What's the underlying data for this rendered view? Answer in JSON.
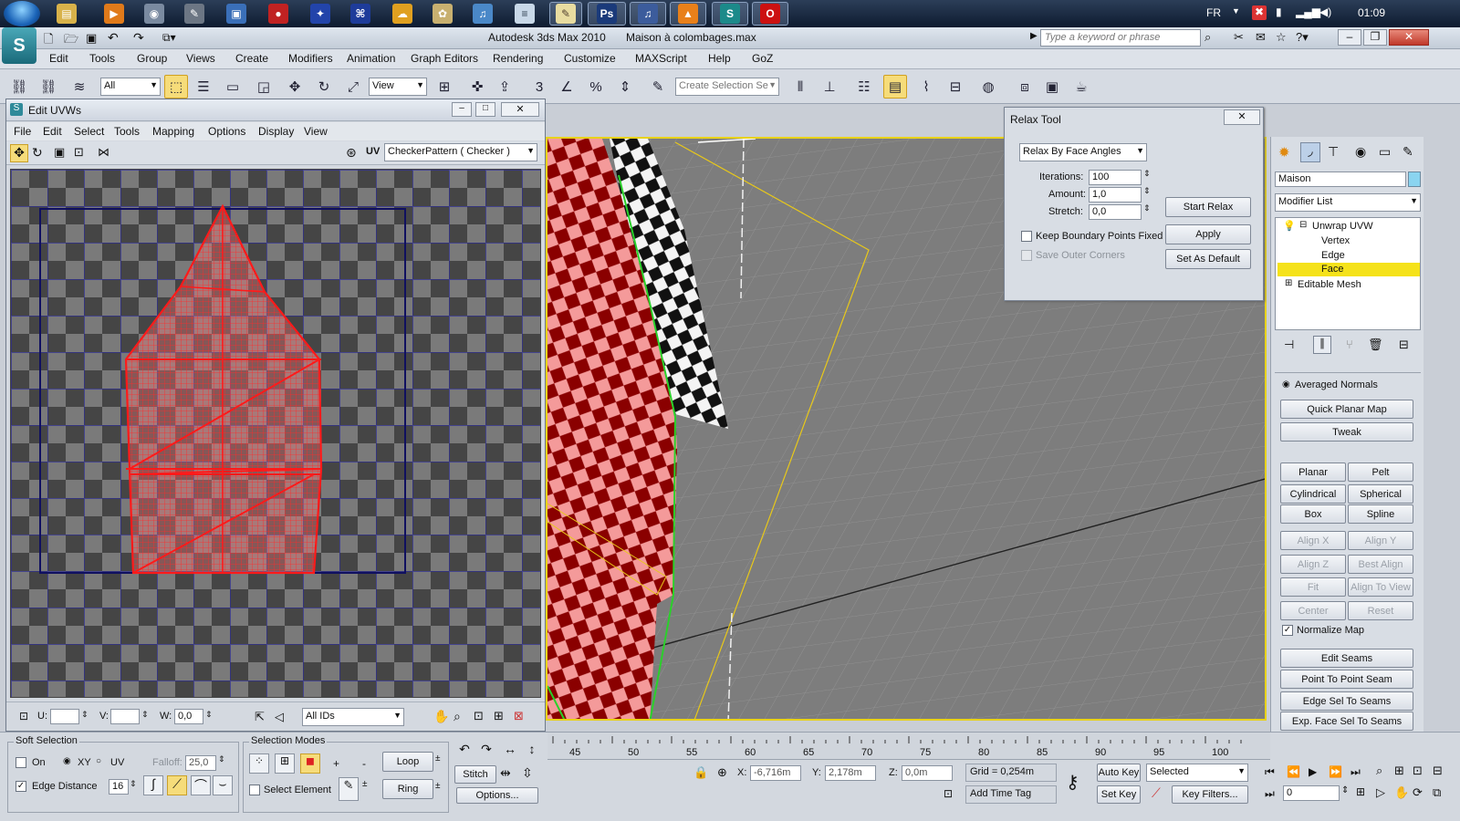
{
  "taskbar": {
    "language": "FR",
    "clock": "01:09"
  },
  "window": {
    "app_title": "Autodesk 3ds Max 2010",
    "file_title": "Maison à colombages.max",
    "search_placeholder": "Type a keyword or phrase"
  },
  "menu": [
    "Edit",
    "Tools",
    "Group",
    "Views",
    "Create",
    "Modifiers",
    "Animation",
    "Graph Editors",
    "Rendering",
    "Customize",
    "MAXScript",
    "Help",
    "GoZ"
  ],
  "toolbar": {
    "filter_value": "All",
    "refcoord_value": "View",
    "selection_set_placeholder": "Create Selection Se"
  },
  "uvw_editor": {
    "title": "Edit UVWs",
    "menu": [
      "File",
      "Edit",
      "Select",
      "Tools",
      "Mapping",
      "Options",
      "Display",
      "View"
    ],
    "uv_label": "UV",
    "texture_value": "CheckerPattern  ( Checker )",
    "u_label": "U:",
    "v_label": "V:",
    "w_label": "W:",
    "w_value": "0,0",
    "ids_value": "All IDs"
  },
  "relax_tool": {
    "title": "Relax Tool",
    "mode_value": "Relax By Face Angles",
    "iterations_label": "Iterations:",
    "iterations_value": "100",
    "amount_label": "Amount:",
    "amount_value": "1,0",
    "stretch_label": "Stretch:",
    "stretch_value": "0,0",
    "keep_boundary_label": "Keep Boundary Points Fixed",
    "save_outer_label": "Save Outer Corners",
    "start_relax_label": "Start Relax",
    "apply_label": "Apply",
    "set_default_label": "Set As Default"
  },
  "command_panel": {
    "object_name": "Maison",
    "modifier_list": "Modifier List",
    "stack": [
      "Unwrap UVW",
      "Vertex",
      "Edge",
      "Face",
      "Editable Mesh"
    ],
    "averaged_normals": "Averaged Normals",
    "buttons": {
      "quick_planar": "Quick Planar Map",
      "tweak": "Tweak",
      "planar": "Planar",
      "pelt": "Pelt",
      "cylindrical": "Cylindrical",
      "spherical": "Spherical",
      "box": "Box",
      "spline": "Spline",
      "align_x": "Align X",
      "align_y": "Align Y",
      "align_z": "Align Z",
      "best_align": "Best Align",
      "fit": "Fit",
      "align_to_view": "Align To View",
      "center": "Center",
      "reset": "Reset",
      "edit_seams": "Edit Seams",
      "point_to_point": "Point To Point Seam",
      "edge_sel_seams": "Edge Sel To Seams",
      "exp_face_sel": "Exp. Face Sel To Seams"
    },
    "normalize_map": "Normalize Map"
  },
  "soft_selection": {
    "title": "Soft Selection",
    "on_label": "On",
    "xy_label": "XY",
    "uv_label": "UV",
    "falloff_label": "Falloff:",
    "falloff_value": "25,0",
    "edge_distance_label": "Edge Distance",
    "edge_distance_value": "16"
  },
  "selection_modes": {
    "title": "Selection Modes",
    "select_element": "Select Element",
    "loop": "Loop",
    "ring": "Ring",
    "stitch": "Stitch",
    "options": "Options..."
  },
  "timeline": {
    "ticks": [
      "45",
      "50",
      "55",
      "60",
      "65",
      "70",
      "75",
      "80",
      "85",
      "90",
      "95",
      "100"
    ]
  },
  "status": {
    "x_label": "X:",
    "x_value": "-6,716m",
    "y_label": "Y:",
    "y_value": "2,178m",
    "z_label": "Z:",
    "z_value": "0,0m",
    "grid": "Grid = 0,254m",
    "add_time_tag": "Add Time Tag",
    "auto_key": "Auto Key",
    "set_key": "Set Key",
    "selected_value": "Selected",
    "key_filters": "Key Filters...",
    "frame_value": "0"
  },
  "colors": {
    "selection_red": "#ff2a2a",
    "highlight_yellow": "#f5e21a",
    "viewport_grey": "#7d7d7d"
  }
}
